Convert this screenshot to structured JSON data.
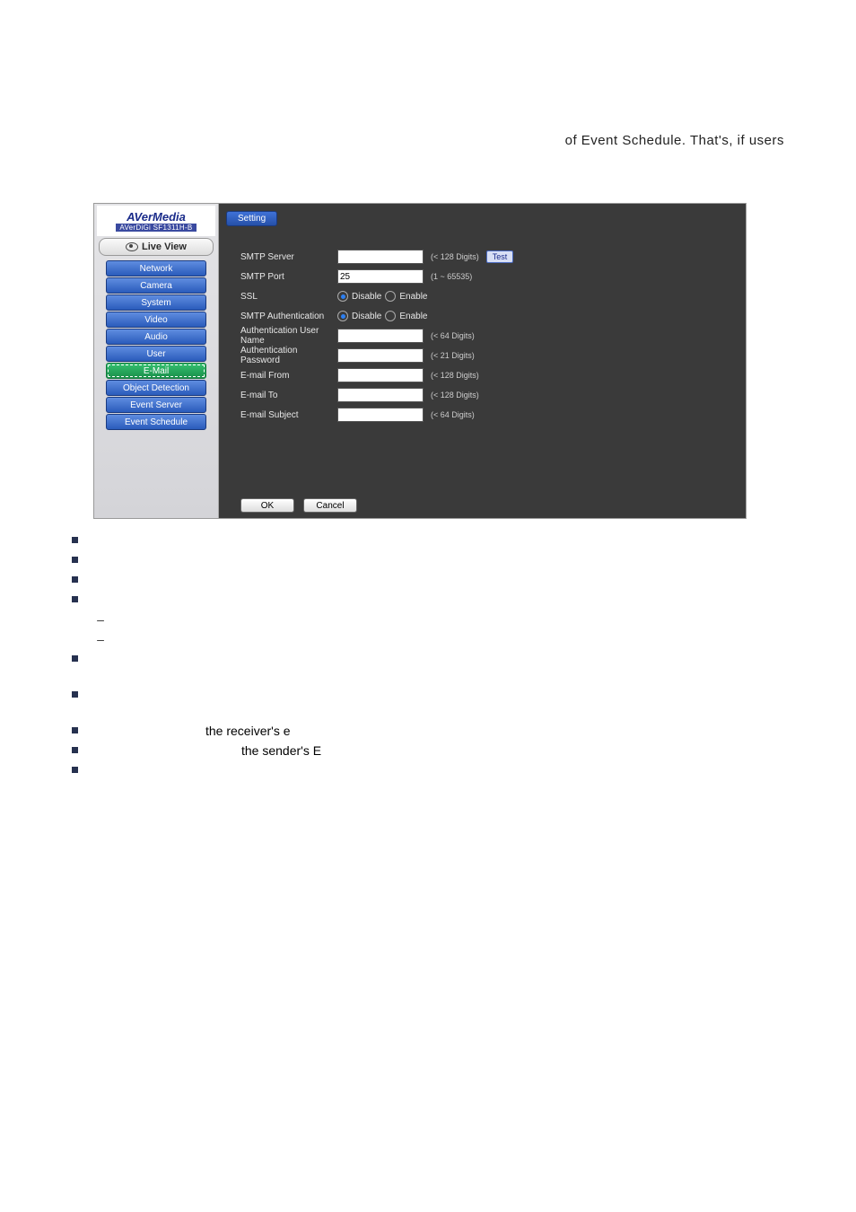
{
  "header_fragment": "of Event Schedule. That's, if users",
  "logo": {
    "main": "AVerMedia",
    "sub": "AVerDiGi SF1311H-B"
  },
  "live_view_label": "Live View",
  "nav": [
    {
      "label": "Network",
      "selected": false
    },
    {
      "label": "Camera",
      "selected": false
    },
    {
      "label": "System",
      "selected": false
    },
    {
      "label": "Video",
      "selected": false
    },
    {
      "label": "Audio",
      "selected": false
    },
    {
      "label": "User",
      "selected": false
    },
    {
      "label": "E-Mail",
      "selected": true
    },
    {
      "label": "Object Detection",
      "selected": false
    },
    {
      "label": "Event Server",
      "selected": false
    },
    {
      "label": "Event Schedule",
      "selected": false
    }
  ],
  "tab_label": "Setting",
  "form": {
    "smtp_server": {
      "label": "SMTP Server",
      "value": "",
      "hint": "(< 128 Digits)"
    },
    "test_label": "Test",
    "smtp_port": {
      "label": "SMTP Port",
      "value": "25",
      "hint": "(1 ~ 65535)"
    },
    "ssl": {
      "label": "SSL",
      "disable": "Disable",
      "enable": "Enable",
      "selected": "disable"
    },
    "smtp_auth": {
      "label": "SMTP Authentication",
      "disable": "Disable",
      "enable": "Enable",
      "selected": "disable"
    },
    "auth_user": {
      "label": "Authentication User Name",
      "value": "",
      "hint": "(< 64 Digits)"
    },
    "auth_pass": {
      "label": "Authentication Password",
      "value": "",
      "hint": "(< 21 Digits)"
    },
    "email_from": {
      "label": "E-mail From",
      "value": "",
      "hint": "(< 128 Digits)"
    },
    "email_to": {
      "label": "E-mail To",
      "value": "",
      "hint": "(< 128 Digits)"
    },
    "email_subject": {
      "label": "E-mail Subject",
      "value": "",
      "hint": "(< 64 Digits)"
    }
  },
  "ok_label": "OK",
  "cancel_label": "Cancel",
  "bullet_text_1": "the receiver's e",
  "bullet_text_2": "the sender's E"
}
